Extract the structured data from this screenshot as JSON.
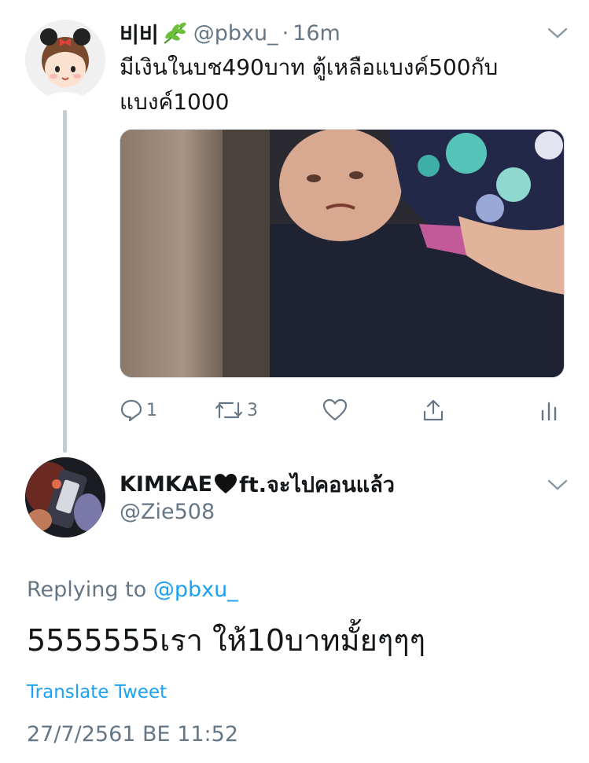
{
  "tweet": {
    "name": "비비",
    "name_emoji_icon": "herb-icon",
    "handle": "@pbxu_",
    "separator": "·",
    "time": "16m",
    "text": "มีเงินในบช490บาท ตู้เหลือแบงค์500กับแบงค์1000",
    "media_icon": "crying-child-photo",
    "actions": {
      "reply_count": "1",
      "retweet_count": "3"
    }
  },
  "reply": {
    "name": "KIMKAE",
    "name_emoji_icon": "black-heart-icon",
    "name_suffix": "ft.จะไปคอนแล้ว",
    "handle": "@Zie508",
    "replying_prefix": "Replying to",
    "replying_handle": "@pbxu_",
    "text": "5555555เรา ให้10บาทมั้ยๆๆๆ",
    "translate_label": "Translate Tweet",
    "timestamp": "27/7/2561 BE 11:52"
  },
  "colors": {
    "text_primary": "#14171a",
    "text_secondary": "#657786",
    "accent": "#1da1f2",
    "thread_line": "#c5cdd3"
  }
}
